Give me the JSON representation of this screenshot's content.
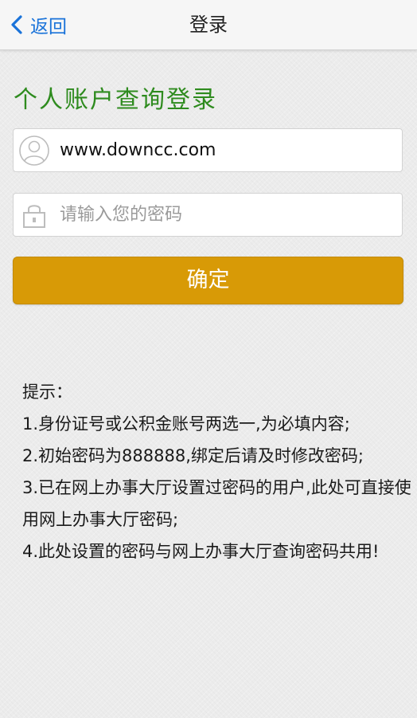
{
  "header": {
    "back_label": "返回",
    "title": "登录"
  },
  "form": {
    "title": "个人账户查询登录",
    "username_value": "www.downcc.com",
    "password_placeholder": "请输入您的密码",
    "confirm_label": "确定"
  },
  "tips": {
    "heading": "提示：",
    "items": [
      "1.身份证号或公积金账号两选一,为必填内容;",
      "2.初始密码为888888,绑定后请及时修改密码;",
      "3.已在网上办事大厅设置过密码的用户,此处可直接使用网上办事大厅密码;",
      "4.此处设置的密码与网上办事大厅查询密码共用!"
    ]
  },
  "colors": {
    "accent_blue": "#1a73d9",
    "title_green": "#2e8b1e",
    "button_gold": "#d89a06",
    "icon_gray": "#bdbdbd"
  },
  "icons": {
    "back": "chevron-left-icon",
    "user": "user-icon",
    "lock": "lock-icon"
  }
}
